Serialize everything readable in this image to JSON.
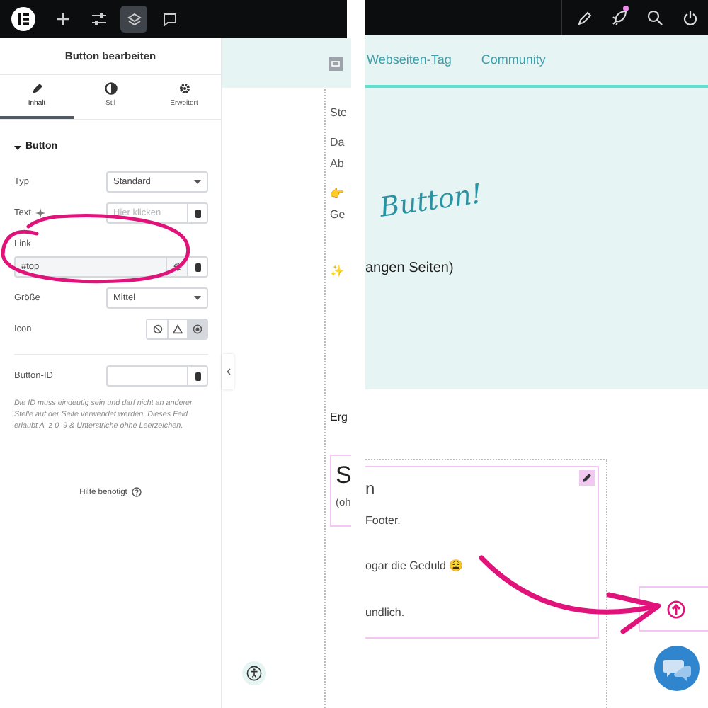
{
  "left_screen": {
    "toolbar": [
      {
        "kind": "add",
        "selected": false
      },
      {
        "kind": "sliders",
        "selected": false
      },
      {
        "kind": "layers",
        "selected": true
      },
      {
        "kind": "comments",
        "selected": false
      }
    ],
    "panel": {
      "title": "Button bearbeiten",
      "tabs": [
        {
          "label": "Inhalt",
          "kind": "pencil",
          "selected": true
        },
        {
          "label": "Stil",
          "kind": "contrast",
          "selected": false
        },
        {
          "label": "Erweitert",
          "kind": "gear",
          "selected": false
        }
      ],
      "section": {
        "title": "Button",
        "expanded": true
      },
      "controls": [
        {
          "kind": "select",
          "label": "Typ",
          "value": "Standard"
        },
        {
          "kind": "text",
          "label": "Text",
          "ai": true,
          "placeholder": "Hier klicken"
        },
        {
          "kind": "link",
          "label": "Link",
          "value": "#top"
        },
        {
          "kind": "select",
          "label": "Größe",
          "value": "Mittel"
        },
        {
          "kind": "choice",
          "label": "Icon",
          "options": [
            {
              "kind": "none",
              "selected": false
            },
            {
              "kind": "triangle",
              "selected": false
            },
            {
              "kind": "dot",
              "selected": true
            }
          ]
        },
        {
          "kind": "divider"
        },
        {
          "kind": "text",
          "label": "Button-ID",
          "ai": false
        }
      ],
      "note": "Die ID muss eindeutig sein und darf nicht an anderer Stelle auf der Seite verwendet werden. Dieses Feld erlaubt A–z  0–9 & Unterstriche ohne Leerzeichen.",
      "help": "Hilfe benötigt"
    },
    "canvas": {
      "lines": [
        "Ste",
        "Da",
        "Ab",
        "👉",
        "Ge",
        "✨",
        "Erg"
      ],
      "box": {
        "heading": "S",
        "text": "(oh"
      }
    }
  },
  "right_screen": {
    "toolbar": [
      {
        "kind": "pencil",
        "notification": false
      },
      {
        "kind": "rocket",
        "notification": true
      },
      {
        "kind": "search",
        "notification": false
      },
      {
        "kind": "power",
        "notification": false
      }
    ],
    "nav": [
      "Webseiten-Tag",
      "Community"
    ],
    "script_title": "Button!",
    "subtitle": "angen Seiten)",
    "card": {
      "lines": [
        "n",
        "Footer.",
        "ogar die Geduld 😩",
        "undlich."
      ]
    }
  }
}
